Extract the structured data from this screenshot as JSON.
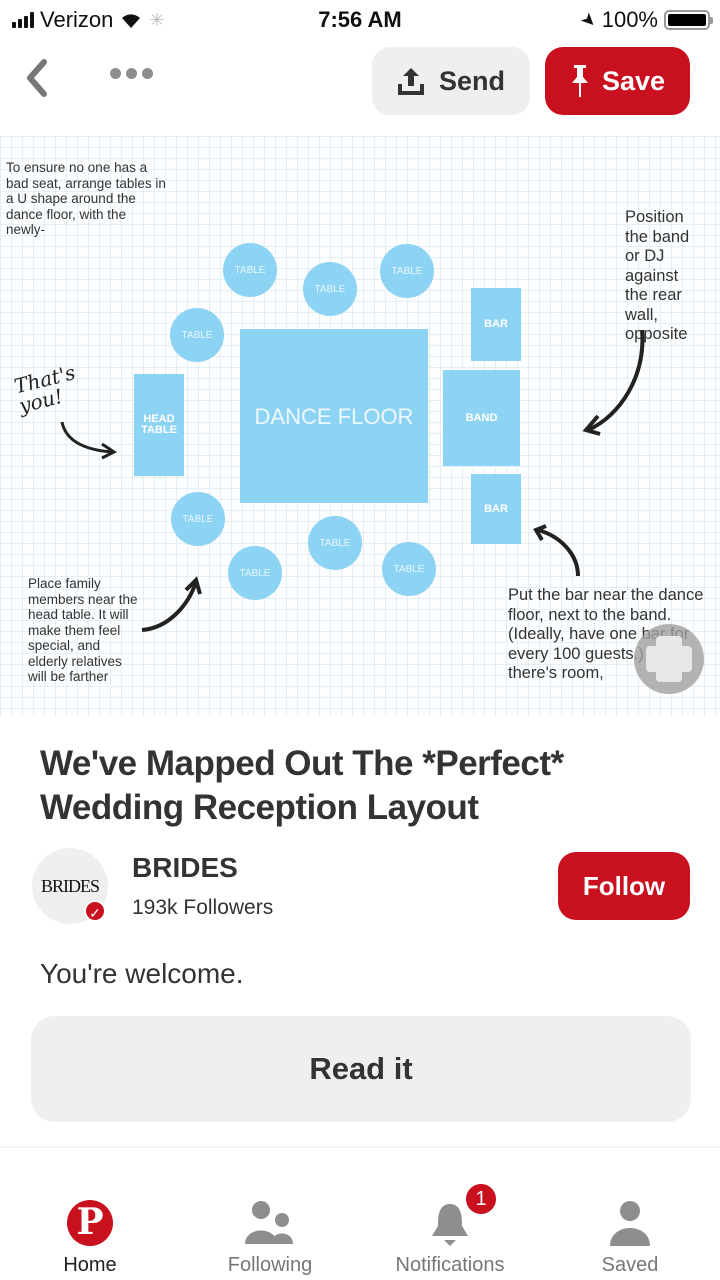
{
  "status_bar": {
    "carrier": "Verizon",
    "time": "7:56 AM",
    "battery": "100%",
    "icons": [
      "signal-icon",
      "wifi-icon",
      "loading-spinner-icon",
      "location-arrow-icon",
      "battery-icon"
    ]
  },
  "toolbar": {
    "back_icon": "chevron-left-icon",
    "more_icon": "more-dots-icon",
    "send_label": "Send",
    "save_label": "Save"
  },
  "pin_image": {
    "notes": {
      "top_left": "To ensure no one has a bad seat, arrange tables in a U shape around the dance floor, with the newly-",
      "top_right": "Position the band or DJ against the rear wall, opposite",
      "handwritten": "That's you!",
      "bottom_left": "Place family members near the head table. It will make them feel special, and elderly relatives will be farther",
      "bottom_right": "Put the bar near the dance floor, next to the band. (Ideally, have one bar for every 100 guests.) If there's room,"
    },
    "labels": {
      "table": "TABLE",
      "head_table": "HEAD TABLE",
      "dance_floor": "DANCE FLOOR",
      "bar": "BAR",
      "band": "BAND"
    }
  },
  "pin": {
    "title": "We've Mapped Out The *Perfect* Wedding Reception Layout",
    "description": "You're welcome.",
    "read_label": "Read it"
  },
  "creator": {
    "avatar_text": "BRIDES",
    "name": "BRIDES",
    "followers": "193k Followers",
    "verified": true,
    "follow_label": "Follow"
  },
  "tabbar": {
    "items": [
      {
        "label": "Home",
        "icon": "pinterest-logo-icon",
        "active": true
      },
      {
        "label": "Following",
        "icon": "people-icon",
        "active": false
      },
      {
        "label": "Notifications",
        "icon": "bell-icon",
        "active": false,
        "badge": "1"
      },
      {
        "label": "Saved",
        "icon": "person-icon",
        "active": false
      }
    ]
  },
  "colors": {
    "brand_red": "#c8101e",
    "button_gray": "#efefef",
    "diagram_blue": "#8dd3f4"
  }
}
